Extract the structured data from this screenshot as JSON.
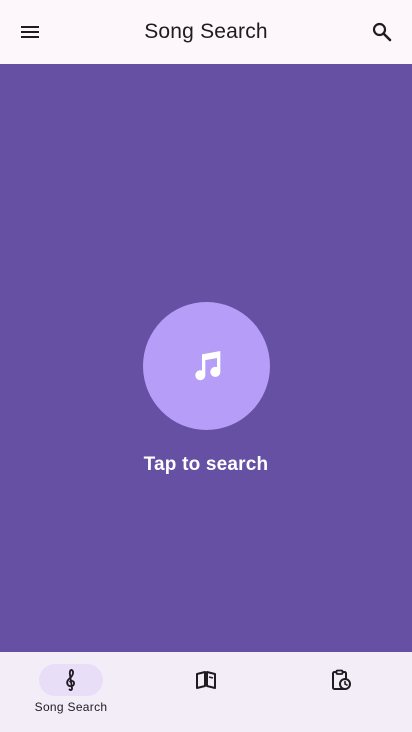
{
  "header": {
    "title": "Song Search",
    "menu_icon": "menu-icon",
    "search_icon": "search-icon"
  },
  "main": {
    "background": "#6650a4",
    "circle_color": "#b69df8",
    "center_icon": "music-note-icon",
    "tap_label": "Tap to search"
  },
  "bottom_nav": {
    "items": [
      {
        "label": "Song Search",
        "icon": "treble-clef-icon",
        "active": true
      },
      {
        "label": "",
        "icon": "library-book-icon",
        "active": false
      },
      {
        "label": "",
        "icon": "history-clipboard-icon",
        "active": false
      }
    ]
  }
}
